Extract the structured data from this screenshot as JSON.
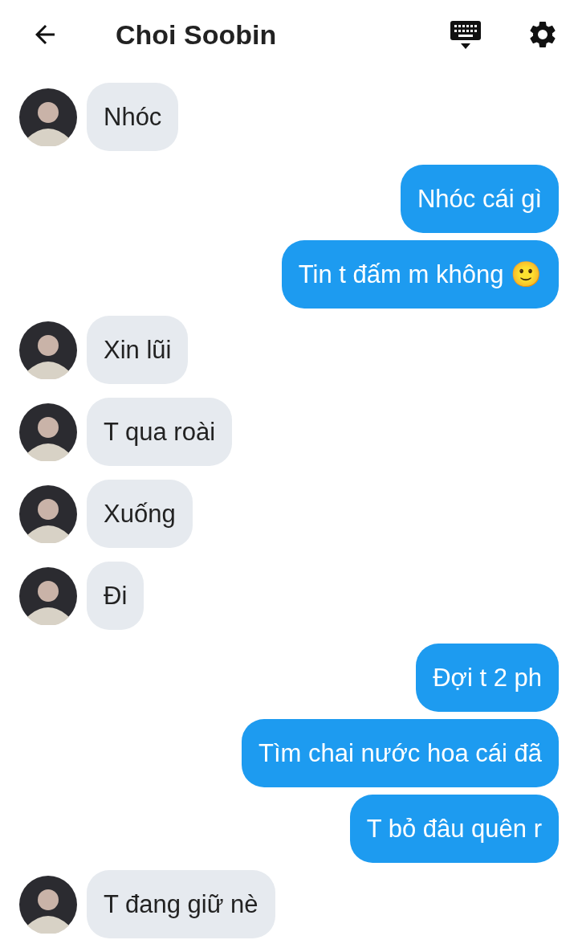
{
  "header": {
    "title": "Choi Soobin"
  },
  "messages": [
    {
      "kind": "incoming",
      "text": "Nhóc"
    },
    {
      "kind": "outgoing",
      "text": "Nhóc cái gì"
    },
    {
      "kind": "outgoing",
      "text": "Tin t đấm m không 🙂"
    },
    {
      "kind": "incoming",
      "text": "Xin lũi"
    },
    {
      "kind": "incoming",
      "text": "T qua roài"
    },
    {
      "kind": "incoming",
      "text": "Xuống"
    },
    {
      "kind": "incoming",
      "text": "Đi"
    },
    {
      "kind": "outgoing",
      "text": "Đợi t 2 ph"
    },
    {
      "kind": "outgoing",
      "text": "Tìm chai nước hoa cái đã"
    },
    {
      "kind": "outgoing",
      "text": "T bỏ đâu quên r"
    },
    {
      "kind": "incoming",
      "text": "T đang giữ nè"
    }
  ]
}
